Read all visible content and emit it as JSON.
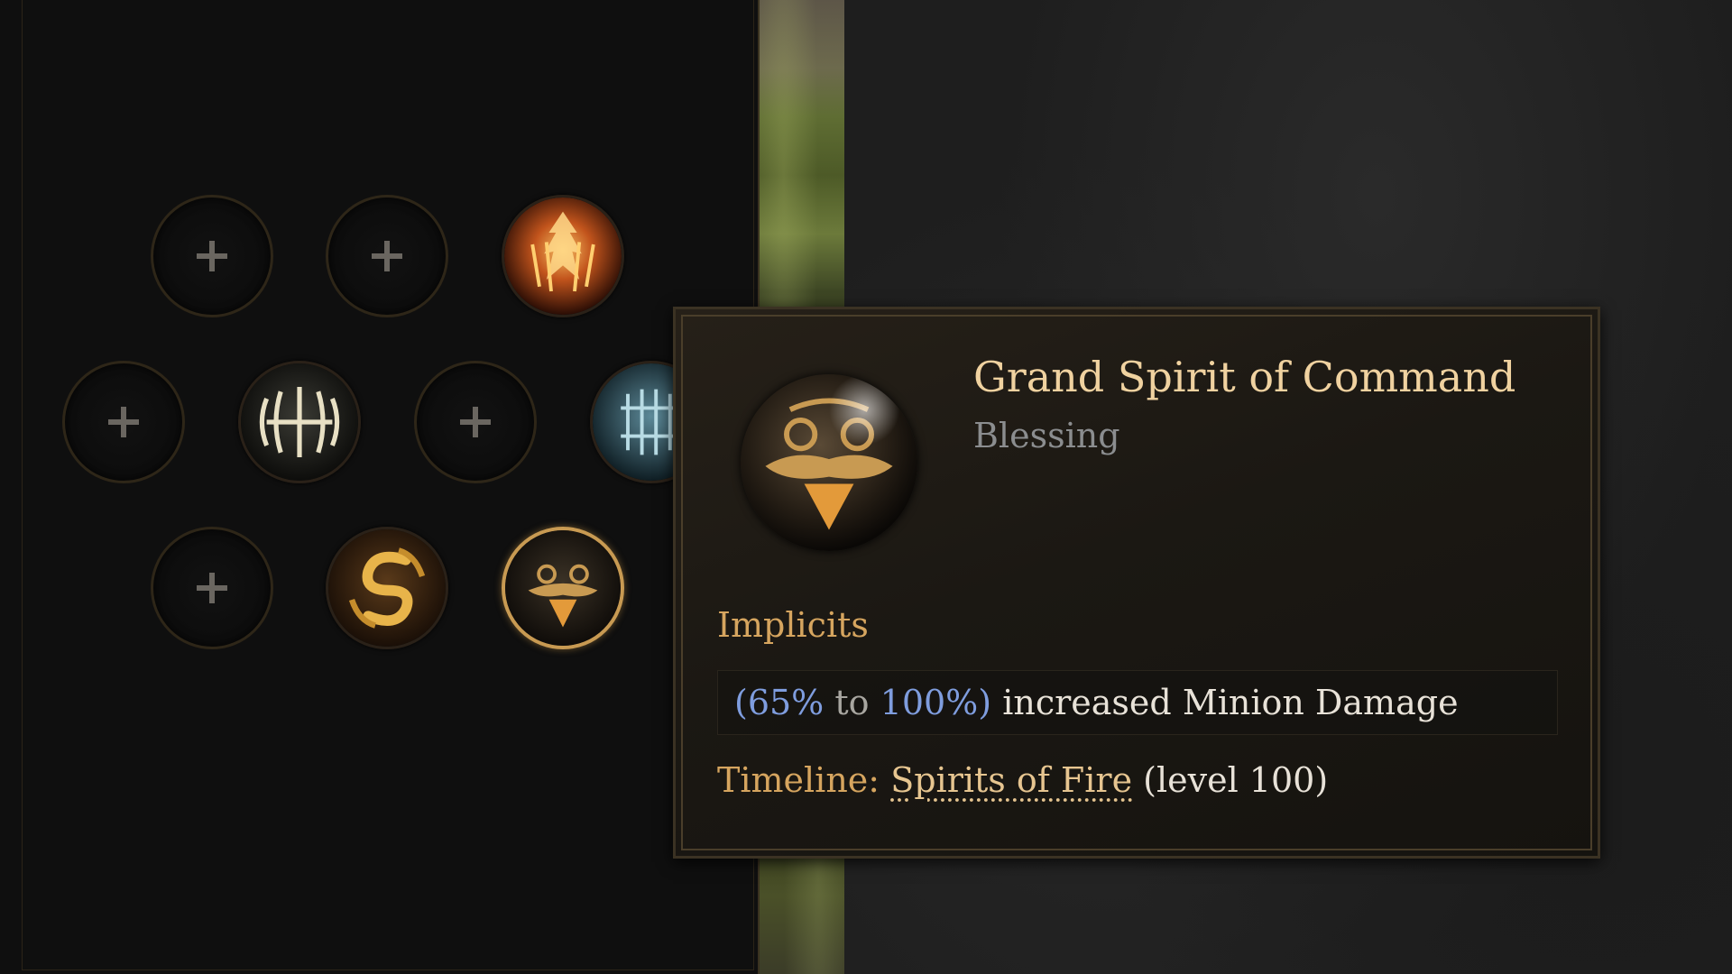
{
  "blessing_slots": [
    {
      "name": "slot-1",
      "state": "empty",
      "icon": "plus-icon"
    },
    {
      "name": "slot-2",
      "state": "empty",
      "icon": "plus-icon"
    },
    {
      "name": "slot-3",
      "state": "filled",
      "icon": "fire-spirit-icon"
    },
    {
      "name": "slot-4",
      "state": "empty",
      "icon": "plus-icon"
    },
    {
      "name": "slot-5",
      "state": "filled",
      "icon": "bone-cage-icon"
    },
    {
      "name": "slot-6",
      "state": "empty",
      "icon": "plus-icon"
    },
    {
      "name": "slot-7",
      "state": "filled",
      "icon": "frost-grid-icon"
    },
    {
      "name": "slot-8",
      "state": "empty",
      "icon": "plus-icon"
    },
    {
      "name": "slot-9",
      "state": "filled",
      "icon": "serpent-coin-icon"
    },
    {
      "name": "slot-10",
      "state": "selected",
      "icon": "spirit-of-command-icon"
    }
  ],
  "tooltip": {
    "title": "Grand Spirit of Command",
    "subtitle": "Blessing",
    "section_label": "Implicits",
    "implicit": {
      "open_paren": "(",
      "min": "65%",
      "to_word": "to",
      "max": "100%",
      "close_paren": ")",
      "text": "increased Minion Damage"
    },
    "timeline": {
      "label": "Timeline:",
      "name": "Spirits of Fire",
      "level": "(level 100)"
    }
  },
  "colors": {
    "title": "#f0d2a0",
    "section": "#d6a55f",
    "range_blue": "#7f9dde",
    "selected_border": "#c89a52"
  }
}
